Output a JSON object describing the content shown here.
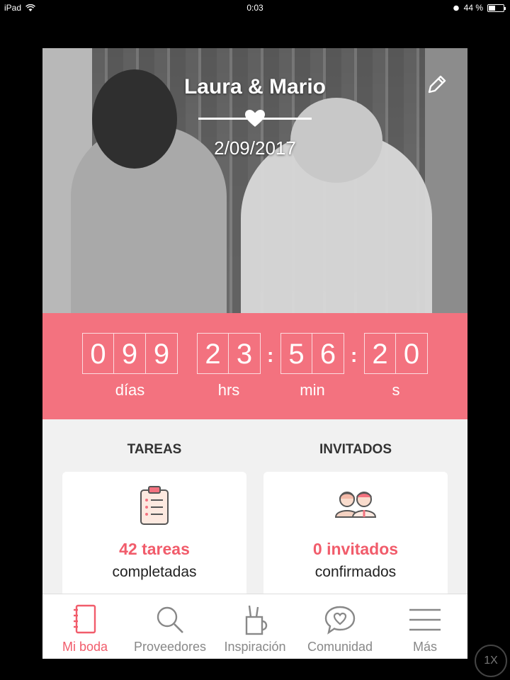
{
  "status_bar": {
    "device": "iPad",
    "time": "0:03",
    "battery": "44 %",
    "battery_level": 0.44
  },
  "hero": {
    "names": "Laura & Mario",
    "date": "2/09/2017"
  },
  "countdown": {
    "days_digits": [
      "0",
      "9",
      "9"
    ],
    "hours_digits": [
      "2",
      "3"
    ],
    "minutes_digits": [
      "5",
      "6"
    ],
    "seconds_digits": [
      "2",
      "0"
    ],
    "days_label": "días",
    "hours_label": "hrs",
    "minutes_label": "min",
    "seconds_label": "s"
  },
  "tasks": {
    "title": "TAREAS",
    "count": "42 tareas",
    "sub": "completadas"
  },
  "guests": {
    "title": "INVITADOS",
    "count": "0 invitados",
    "sub": "confirmados"
  },
  "tabs": [
    {
      "label": "Mi boda",
      "icon": "notebook-icon",
      "active": true
    },
    {
      "label": "Proveedores",
      "icon": "search-icon",
      "active": false
    },
    {
      "label": "Inspiración",
      "icon": "pencil-cup-icon",
      "active": false
    },
    {
      "label": "Comunidad",
      "icon": "heart-chat-icon",
      "active": false
    },
    {
      "label": "Más",
      "icon": "menu-icon",
      "active": false
    }
  ],
  "zoom": "1X",
  "colors": {
    "accent": "#f3727f",
    "accent_text": "#f15c6b"
  }
}
